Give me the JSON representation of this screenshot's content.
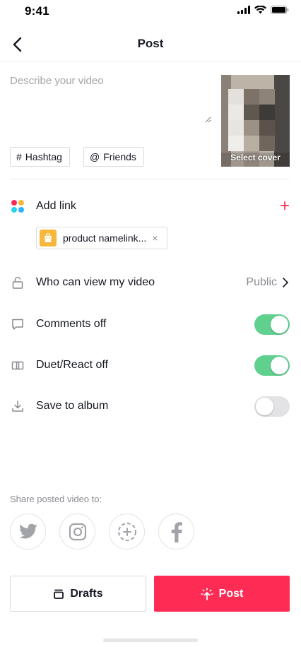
{
  "status_bar": {
    "time": "9:41"
  },
  "header": {
    "title": "Post"
  },
  "caption": {
    "placeholder": "Describe your video",
    "value": ""
  },
  "chips": {
    "hashtag_label": "Hashtag",
    "hashtag_symbol": "#",
    "friends_label": "Friends",
    "friends_symbol": "@"
  },
  "cover": {
    "label": "Select cover"
  },
  "add_link": {
    "label": "Add link",
    "action_symbol": "+",
    "product": {
      "name": "product namelink...",
      "remove_symbol": "×"
    }
  },
  "settings": [
    {
      "label": "Who can view my video",
      "value": "Public",
      "icon": "lock-icon"
    },
    {
      "label": "Comments off",
      "enabled": true,
      "icon": "comment-icon"
    },
    {
      "label": "Duet/React off",
      "enabled": true,
      "icon": "duet-icon"
    },
    {
      "label": "Save to album",
      "enabled": false,
      "icon": "download-icon"
    }
  ],
  "share": {
    "title": "Share posted video to:",
    "targets": [
      "twitter-icon",
      "instagram-icon",
      "add-story-icon",
      "facebook-icon"
    ]
  },
  "footer": {
    "drafts_label": "Drafts",
    "post_label": "Post"
  },
  "colors": {
    "accent": "#fe2c55",
    "toggle_on": "#5fd08e",
    "toggle_off": "#e3e3e6",
    "muted_text": "#8a8b91"
  }
}
